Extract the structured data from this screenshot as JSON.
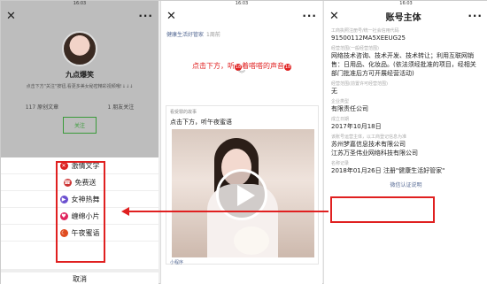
{
  "panel1": {
    "status_left": "",
    "status_time": "16:03",
    "status_right": "",
    "profile_name": "九点爆笑",
    "profile_desc": "点击下方\"关注\"按钮,看更多美女秘密精彩视频哦!↓↓↓",
    "stat_articles": "117 原创文章",
    "stat_following": "1 朋友关注",
    "follow_label": "关注",
    "menu": [
      {
        "label": "激情文学",
        "icon": "cross-icon",
        "color": "#d22"
      },
      {
        "label": "免费送",
        "icon": "phone-icon",
        "color": "#c33"
      },
      {
        "label": "女神热舞",
        "icon": "video-icon",
        "color": "#6b4fcf"
      },
      {
        "label": "缠绵小片",
        "icon": "heart-icon",
        "color": "#e0245e"
      },
      {
        "label": "午夜蜜语",
        "icon": "moon-icon",
        "color": "#e04b1f"
      }
    ],
    "cancel_label": "取消"
  },
  "panel2": {
    "status_time": "16:03",
    "account_name": "健康生活好管家",
    "posted_ago": "1周前",
    "hint_text": "点击下方，听",
    "hint_badge": "18",
    "hint_text2": "着嗒嗒的声音",
    "hint_badge2": "18",
    "card_source": "看受罪的故事",
    "card_desc": "点击下方，听午夜蜜语",
    "mini_program": "小程序"
  },
  "panel3": {
    "status_time": "16:03",
    "title": "账号主体",
    "fields": [
      {
        "label": "工商执照注册号/统一社会信用代码",
        "value": "91500112MA5XEEUG25"
      },
      {
        "label": "经营范围(一般经营范围)",
        "value": "网络技术咨询、技术开发、技术转让；利用互联网销售：日用品、化妆品。(依法须经批准的项目，经相关部门批准后方可开展经营活动)"
      },
      {
        "label": "经营范围(前置许可经营范围)",
        "value": "无"
      },
      {
        "label": "企业类型",
        "value": "有限责任公司"
      },
      {
        "label": "成立日期",
        "value": "2017年10月18日"
      },
      {
        "label": "该账号运营主体，以工商登记信息为准",
        "value": "苏州梦嘉信息技术有限公司"
      },
      {
        "label": "",
        "value": "江苏万圣伟业网络科技有限公司"
      },
      {
        "label": "名称记录",
        "value": "2018年01月26日 注册\"健康生活好管家\""
      }
    ],
    "link": "微信认证说明"
  },
  "accent_red": "#e02020",
  "link_color": "#576b95"
}
